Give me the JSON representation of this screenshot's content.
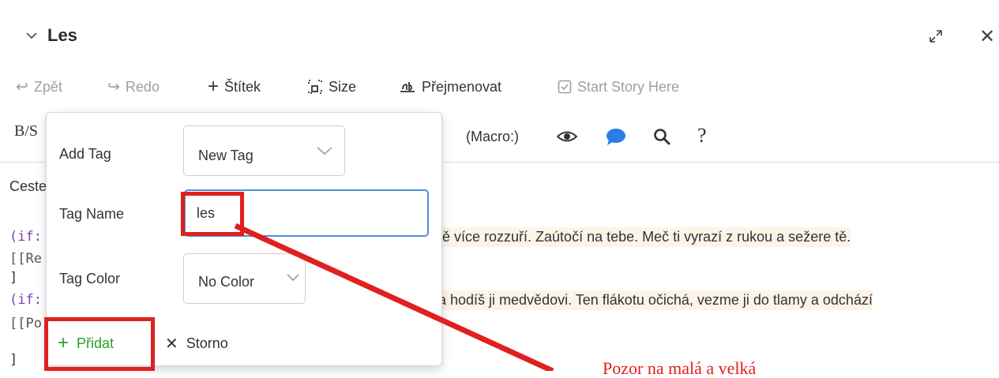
{
  "dialog": {
    "title": "Les"
  },
  "toolbar": {
    "undo": "Zpět",
    "redo": "Redo",
    "tag": "Štítek",
    "size": "Size",
    "rename": "Přejmenovat",
    "start": "Start Story Here"
  },
  "macrobar": {
    "bs": "B/S",
    "macro": "(Macro:)"
  },
  "content": {
    "line1": "Ceste",
    "if1_code": "(if:",
    "if1_text": "tě více rozzuří. Zaútočí na tebe. Meč ti vyrazí z rukou a sežere tě.",
    "link1": "[[Re",
    "bracket1": "]",
    "if2_code": "(if:",
    "if2_text": "a hodíš ji medvědovi. Ten flákotu očichá, vezme ji do tlamy a odchází",
    "link2": "[[Po",
    "bracket2": "]"
  },
  "popup": {
    "add_tag_label": "Add Tag",
    "add_tag_value": "New Tag",
    "tag_name_label": "Tag Name",
    "tag_name_value": "les",
    "tag_color_label": "Tag Color",
    "tag_color_value": "No Color",
    "add_button": "Přidat",
    "cancel_button": "Storno"
  },
  "annotation": {
    "note": "Pozor na malá a velká"
  },
  "colors": {
    "accent_green": "#2aa12a",
    "annotation_red": "#e0201f",
    "focus_blue": "#4a90e2"
  }
}
